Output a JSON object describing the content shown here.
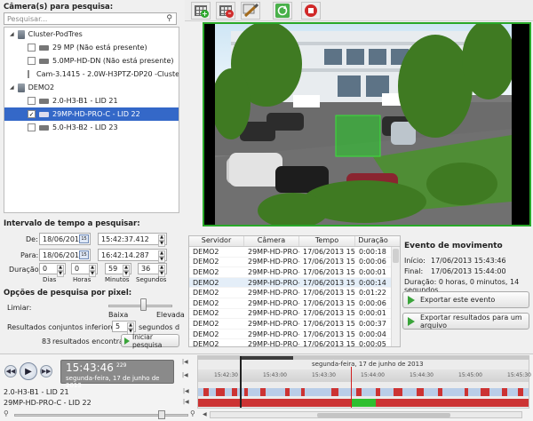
{
  "left": {
    "cameras_label": "Câmera(s) para pesquisa:",
    "search_placeholder": "Pesquisar...",
    "tree": [
      {
        "label": "Cluster-PodTres",
        "type": "server"
      },
      {
        "label": "29 MP (Não está presente)",
        "type": "camera"
      },
      {
        "label": "5.0MP-HD-DN (Não está presente)",
        "type": "camera"
      },
      {
        "label": "Cam-3.1415 - 2.0W-H3PTZ-DP20 -Cluster Pod",
        "type": "camera"
      },
      {
        "label": "DEMO2",
        "type": "server"
      },
      {
        "label": "2.0-H3-B1 - LID 21",
        "type": "camera"
      },
      {
        "label": "29MP-HD-PRO-C - LID 22",
        "type": "camera",
        "selected": true
      },
      {
        "label": "5.0-H3-B2 - LID 23",
        "type": "camera"
      }
    ],
    "time_range_label": "Intervalo de tempo a pesquisar:",
    "de_label": "De:",
    "de_date": "18/06/2013",
    "de_time": "15:42:37.412",
    "para_label": "Para:",
    "para_date": "18/06/2013",
    "para_time": "16:42:14.287",
    "duracao_label": "Duração:",
    "dias_val": "0",
    "horas_val": "0",
    "minutos_val": "59",
    "segundos_val": "36",
    "dias": "Dias",
    "horas": "Horas",
    "minutos": "Minutos",
    "segundos": "Segundos",
    "pixel_options_label": "Opções de pesquisa por pixel:",
    "limiar": "Limiar:",
    "baixa": "Baixa",
    "elevada": "Elevada",
    "resultados_label": "Resultados conjuntos inferiores a",
    "resultados_val": "5",
    "segundos_de": "segundos de di",
    "found_count": "83",
    "found_text": "resultados encontrados",
    "search_button": "Iniciar pesquisa"
  },
  "table": {
    "headers": [
      "Servidor",
      "Câmera",
      "Tempo",
      "Duração"
    ],
    "rows": [
      [
        "DEMO2",
        "29MP-HD-PRO-C",
        "17/06/2013 15:42",
        "0:00:18"
      ],
      [
        "DEMO2",
        "29MP-HD-PRO-C",
        "17/06/2013 15:43",
        "0:00:06"
      ],
      [
        "DEMO2",
        "29MP-HD-PRO-C",
        "17/06/2013 15:43",
        "0:00:01"
      ],
      [
        "DEMO2",
        "29MP-HD-PRO-C",
        "17/06/2013 15:43",
        "0:00:14"
      ],
      [
        "DEMO2",
        "29MP-HD-PRO-C",
        "17/06/2013 15:44",
        "0:01:22"
      ],
      [
        "DEMO2",
        "29MP-HD-PRO-C",
        "17/06/2013 15:45",
        "0:00:06"
      ],
      [
        "DEMO2",
        "29MP-HD-PRO-C",
        "17/06/2013 15:45",
        "0:00:01"
      ],
      [
        "DEMO2",
        "29MP-HD-PRO-C",
        "17/06/2013 15:45",
        "0:00:37"
      ],
      [
        "DEMO2",
        "29MP-HD-PRO-C",
        "17/06/2013 15:46",
        "0:00:04"
      ],
      [
        "DEMO2",
        "29MP-HD-PRO-C",
        "17/06/2013 15:47",
        "0:00:05"
      ]
    ]
  },
  "event": {
    "title": "Evento de movimento",
    "inicio_label": "Início:",
    "inicio": "17/06/2013 15:43:46",
    "final_label": "Final:",
    "final": "17/06/2013 15:44:00",
    "duracao": "Duração: 0 horas, 0 minutos, 14 segundos",
    "export_event": "Exportar este evento",
    "export_results": "Exportar resultados para um arquivo"
  },
  "playback": {
    "time": "15:43:46",
    "ms": "229",
    "date": "segunda-feira, 17 de junho de 2013"
  },
  "timeline": {
    "date_label": "segunda-feira, 17 de junho de 2013",
    "ticks": [
      "15:42:30",
      "15:43:00",
      "15:43:30",
      "15:44:00",
      "15:44:30",
      "15:45:00",
      "15:45:30"
    ],
    "tracks": [
      "2.0-H3-B1 - LID 21",
      "29MP-HD-PRO-C - LID 22"
    ]
  },
  "colors": {
    "selected": "#3468c8",
    "motion": "#cc3333",
    "recording": "#a9c4ec",
    "highlight_motion": "#2fbf2f"
  },
  "icons": {
    "toolbar": [
      "add-camera-icon",
      "remove-camera-icon",
      "draw-mask-icon",
      "refresh-icon",
      "stop-icon"
    ]
  }
}
